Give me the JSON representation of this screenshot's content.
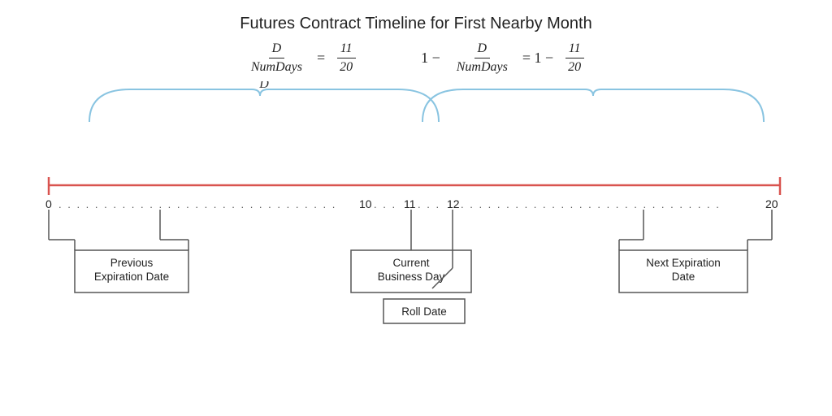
{
  "title": "Futures Contract Timeline for First Nearby Month",
  "formula_left": {
    "numerator": "D",
    "denominator": "NumDays",
    "equals": "=",
    "value_num": "11",
    "value_den": "20"
  },
  "formula_right": {
    "prefix": "1 −",
    "numerator": "D",
    "denominator": "NumDays",
    "equals": "= 1 −",
    "value_num": "11",
    "value_den": "20"
  },
  "timeline": {
    "d_label": "D",
    "tick_labels": [
      "0",
      "10",
      "11",
      "12",
      "20"
    ],
    "dots_left": "· · · · · · · · · · · · · · · · · · · · · · · · · · · · · ·",
    "dots_middle": "· · ·",
    "dots_right": "· · · · · · · · · · · · · · · · · · · · · · · · · · · · ·"
  },
  "labels": {
    "prev_expiration": "Previous\nExpiration Date",
    "current_business": "Current\nBusiness Day",
    "next_expiration": "Next Expiration\nDate",
    "roll_date": "Roll Date"
  }
}
